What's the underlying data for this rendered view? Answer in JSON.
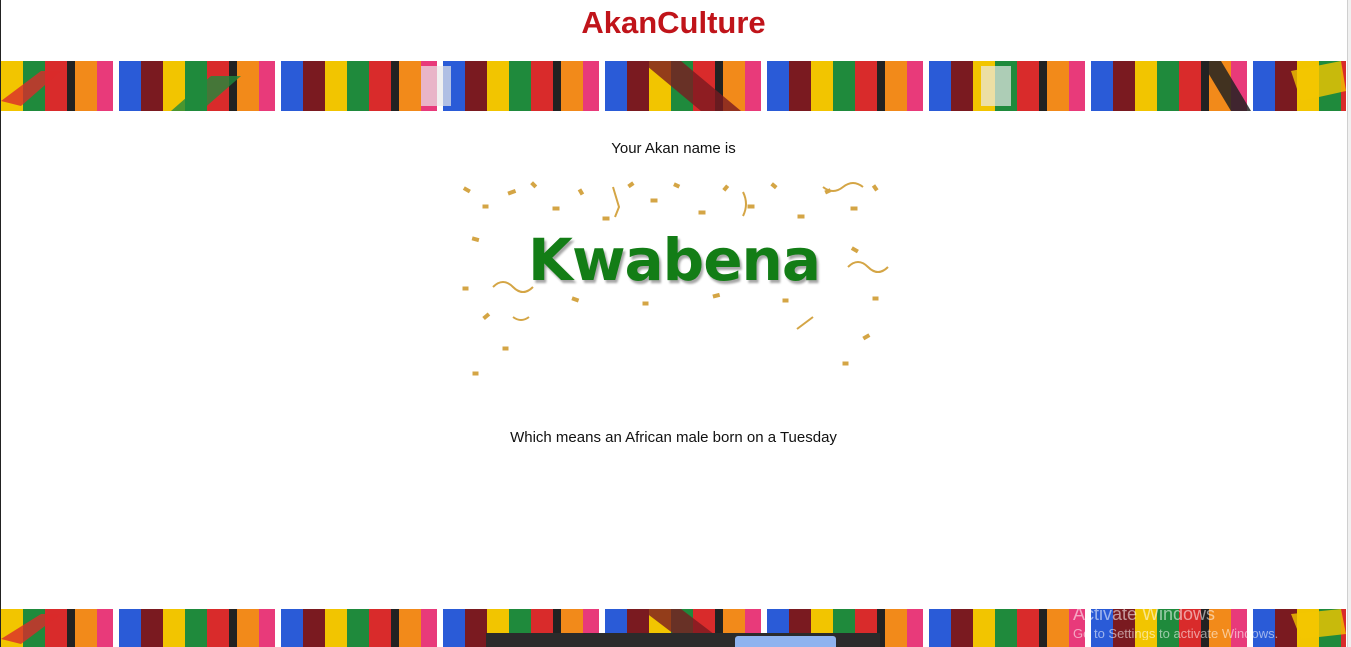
{
  "header": {
    "title": "AkanCulture"
  },
  "result": {
    "intro": "Your Akan name is",
    "name": "Kwabena",
    "meaning": "Which means an African male born on a Tuesday"
  },
  "colors": {
    "title": "#c0141a",
    "name": "#137d16",
    "confetti": "#d4a545",
    "background": "#ffffff"
  },
  "icons": {
    "banner": "kente-cloth-banner",
    "confetti": "confetti-image"
  },
  "watermark": {
    "title": "Activate Windows",
    "subtitle": "Go to Settings to activate Windows."
  }
}
